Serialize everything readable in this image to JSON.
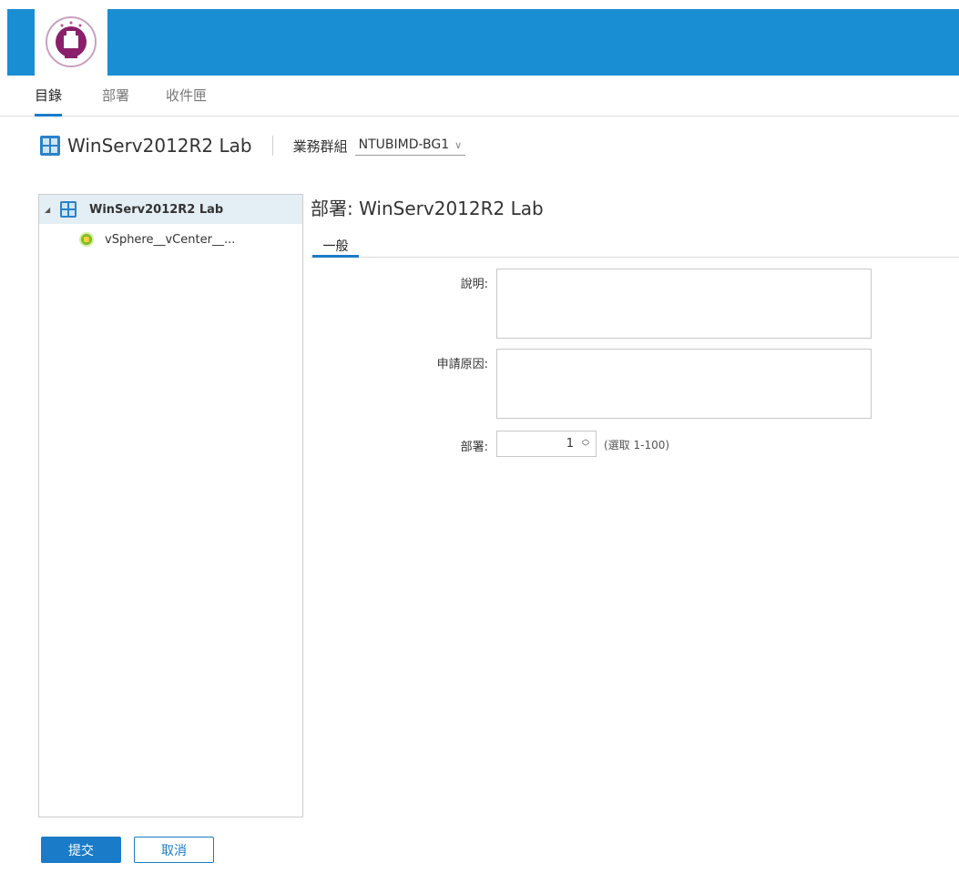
{
  "nav": {
    "tabs": [
      {
        "label": "目錄",
        "active": true
      },
      {
        "label": "部署",
        "active": false
      },
      {
        "label": "收件匣",
        "active": false
      }
    ]
  },
  "header": {
    "blueprint_title": "WinServ2012R2 Lab",
    "business_group_label": "業務群組",
    "business_group_value": "NTUBIMD-BG1"
  },
  "tree": {
    "items": [
      {
        "label": "WinServ2012R2 Lab",
        "icon": "blueprint-icon",
        "selected": true
      },
      {
        "label": "vSphere__vCenter__...",
        "icon": "vm-icon",
        "selected": false
      }
    ]
  },
  "detail": {
    "title": "部署: WinServ2012R2 Lab",
    "tab_general": "一般",
    "description_label": "說明:",
    "description_value": "",
    "reason_label": "申請原因:",
    "reason_value": "",
    "deployments_label": "部署:",
    "deployments_value": "1",
    "deployments_hint": "(選取 1-100)"
  },
  "footer": {
    "submit_label": "提交",
    "cancel_label": "取消"
  },
  "colors": {
    "topbar": "#1a8ed2",
    "accent": "#1a7bc8",
    "selected_row": "#e4eef5"
  }
}
